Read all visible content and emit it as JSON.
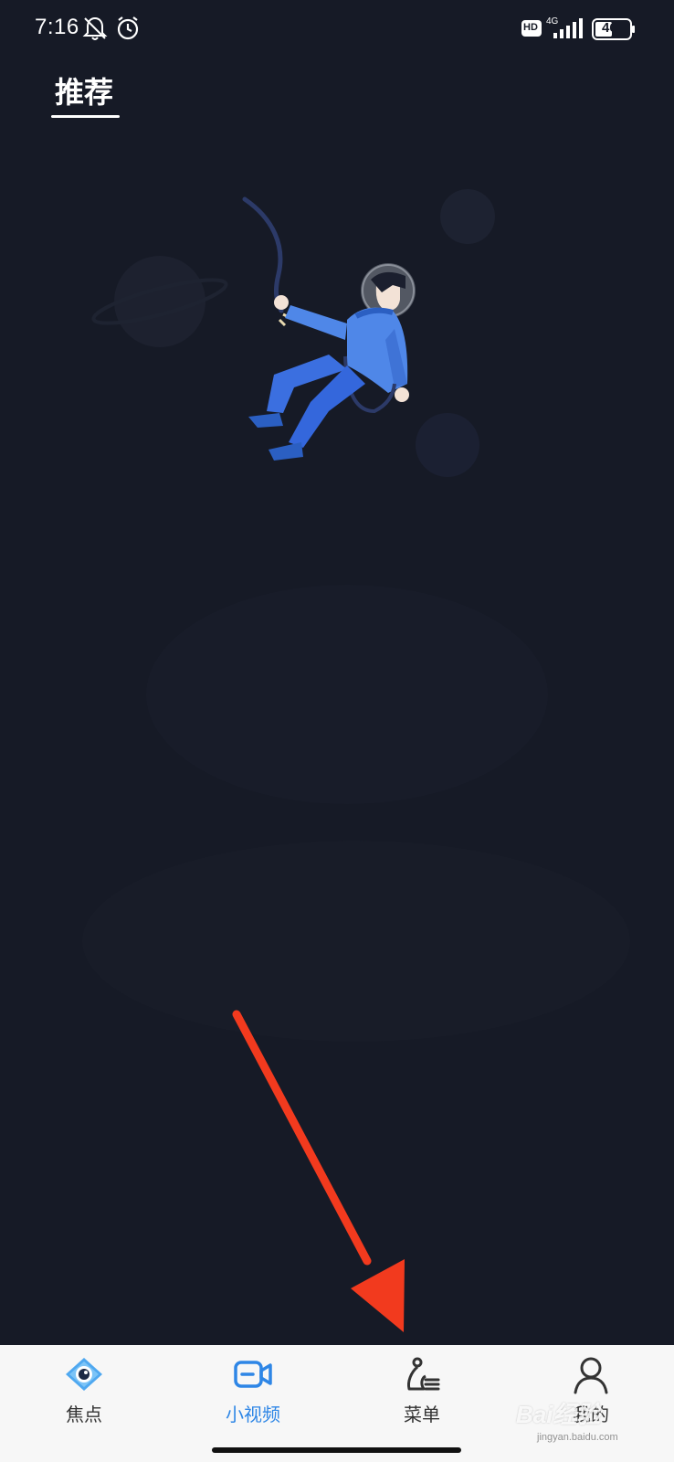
{
  "status_bar": {
    "time": "7:16",
    "network": "4G",
    "hd": "HD",
    "battery": "46"
  },
  "top_tabs": {
    "active": "推荐"
  },
  "bottom_nav": {
    "items": [
      {
        "label": "焦点",
        "icon": "eye-icon",
        "active": false
      },
      {
        "label": "小视频",
        "icon": "video-camera-icon",
        "active": true
      },
      {
        "label": "菜单",
        "icon": "menu-person-icon",
        "active": false
      },
      {
        "label": "我的",
        "icon": "person-icon",
        "active": false
      }
    ]
  },
  "watermark": {
    "text": "Bai经验",
    "sub": "jingyan.baidu.com"
  },
  "colors": {
    "background": "#161a26",
    "accent": "#2e86e6",
    "arrow": "#f23a1e"
  }
}
